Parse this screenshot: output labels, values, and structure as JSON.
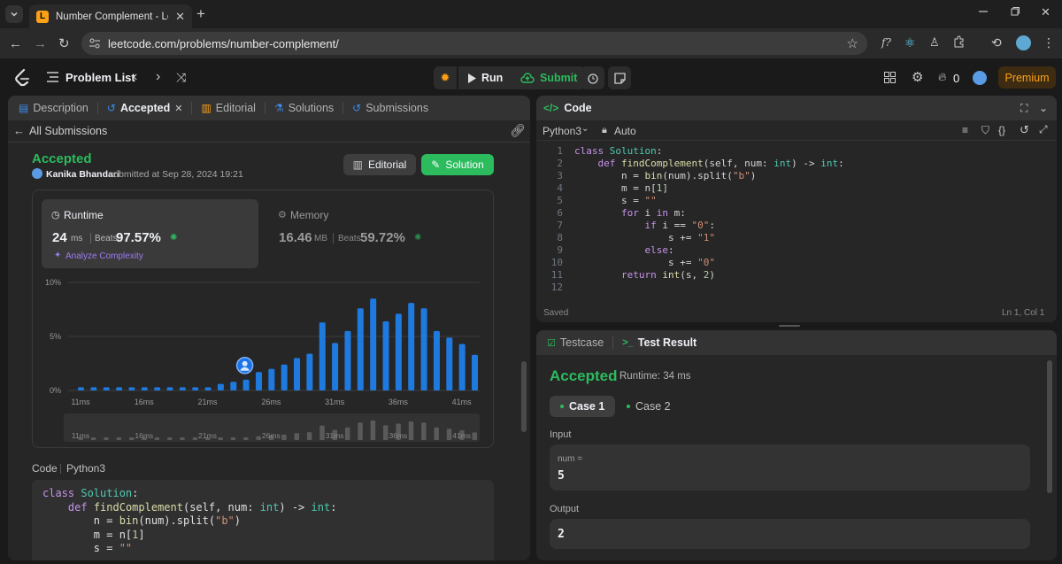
{
  "browser": {
    "tab_title": "Number Complement - LeetCode",
    "url": "leetcode.com/problems/number-complement/"
  },
  "nav": {
    "problem_list": "Problem List",
    "run": "Run",
    "submit": "Submit",
    "streak": "0",
    "premium": "Premium"
  },
  "left": {
    "tabs": [
      "Description",
      "Accepted",
      "Editorial",
      "Solutions",
      "Submissions"
    ],
    "all_submissions": "All Submissions",
    "status": "Accepted",
    "user": "Kanika Bhandari",
    "submitted_text": "submitted at Sep 28, 2024 19:21",
    "editorial_btn": "Editorial",
    "solution_btn": "Solution",
    "runtime": {
      "label": "Runtime",
      "value": "24",
      "unit": "ms",
      "beats_label": "Beats",
      "beats": "97.57%",
      "analyze": "Analyze Complexity"
    },
    "memory": {
      "label": "Memory",
      "value": "16.46",
      "unit": "MB",
      "beats_label": "Beats",
      "beats": "59.72%"
    },
    "code_label": "Code",
    "code_lang": "Python3"
  },
  "chart_data": {
    "type": "bar",
    "y_tick_labels": [
      "10%",
      "5%",
      "0%"
    ],
    "ylim": [
      0,
      10
    ],
    "x_tick_labels": [
      "11ms",
      "16ms",
      "21ms",
      "26ms",
      "31ms",
      "36ms",
      "41ms"
    ],
    "values": [
      0.3,
      0.3,
      0.3,
      0.3,
      0.3,
      0.3,
      0.3,
      0.3,
      0.3,
      0.3,
      0.3,
      0.6,
      0.8,
      1.0,
      1.7,
      2.0,
      2.4,
      3.0,
      3.4,
      6.3,
      4.4,
      5.5,
      7.6,
      8.5,
      6.4,
      7.1,
      8.1,
      7.6,
      5.5,
      4.9,
      4.3,
      3.3
    ],
    "highlight_index": 13,
    "grid": true,
    "highlight_color": "#1a73e8",
    "bar_color": "#1f7ae0"
  },
  "right": {
    "code_title": "Code",
    "lang": "Python3",
    "auto": "Auto",
    "saved": "Saved",
    "cursor": "Ln 1, Col 1",
    "line_numbers": [
      "1",
      "2",
      "3",
      "4",
      "5",
      "6",
      "7",
      "8",
      "9",
      "10",
      "11",
      "12"
    ],
    "testcase_tab": "Testcase",
    "result_tab": "Test Result",
    "result_status": "Accepted",
    "result_runtime": "Runtime: 34 ms",
    "case1": "Case 1",
    "case2": "Case 2",
    "input_label": "Input",
    "input_var": "num =",
    "input_value": "5",
    "output_label": "Output",
    "output_value": "2"
  },
  "colors": {
    "accent_green": "#2cbb5d",
    "accent_orange": "#ffa116",
    "bg": "#1a1a1a",
    "panel": "#262626"
  }
}
